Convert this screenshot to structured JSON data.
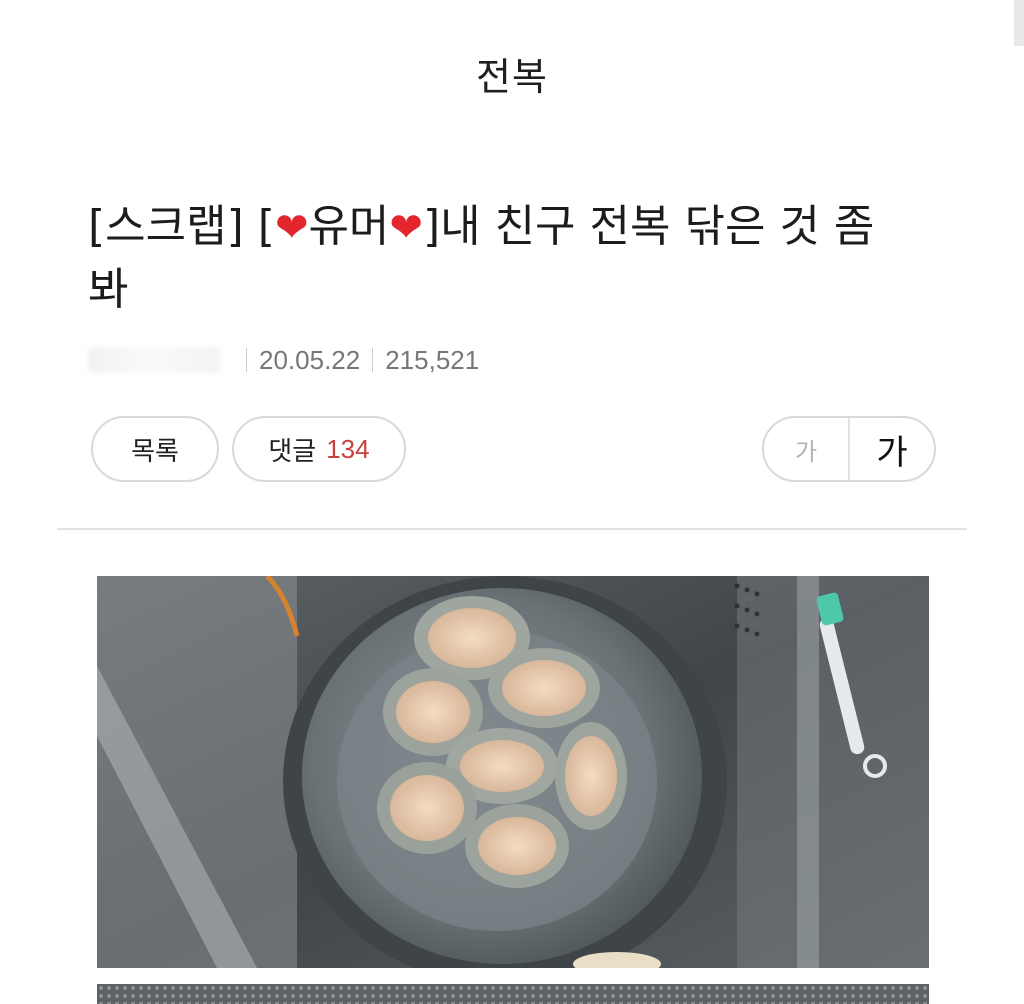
{
  "header": {
    "board_title": "전복"
  },
  "post": {
    "title_prefix": "[스크랩] [",
    "title_word": "유머",
    "title_rest": "]내 친구 전복 닦은 것 좀",
    "title_line2": "봐",
    "heart_glyph": "❤",
    "date": "20.05.22",
    "views": "215,521"
  },
  "actions": {
    "list_label": "목록",
    "comment_label": "댓글",
    "comment_count": "134",
    "font_small_label": "가",
    "font_large_label": "가"
  },
  "colors": {
    "accent_count": "#c8413c",
    "heart": "#e3262c",
    "border": "#d9d9d9"
  },
  "media": {
    "photo_1": "abalone-in-bowl-photo",
    "photo_2": "sink-strainer-photo"
  }
}
